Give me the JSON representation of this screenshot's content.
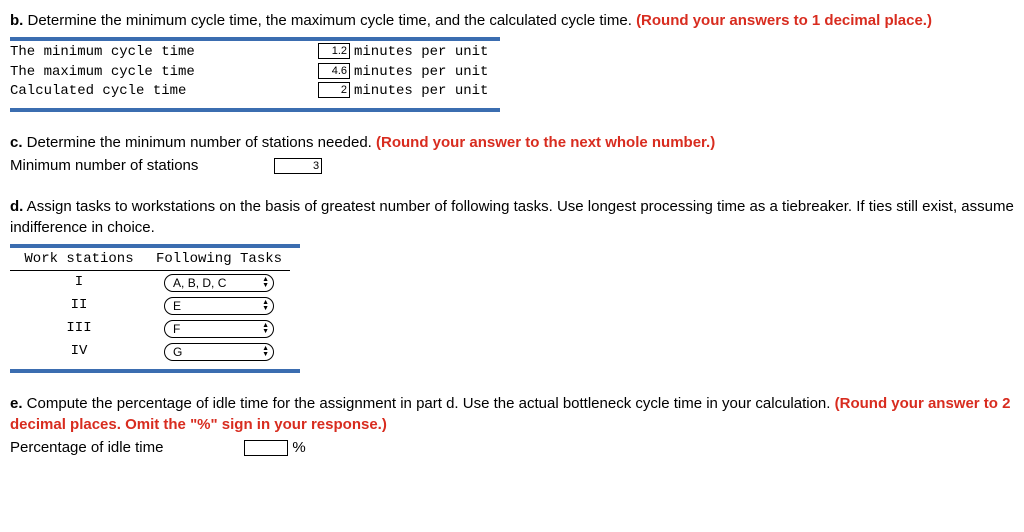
{
  "b": {
    "label": "b.",
    "text": " Determine the minimum cycle time, the maximum cycle time, and the calculated cycle time. ",
    "hint": "(Round your answers to 1 decimal place.)",
    "rows": [
      {
        "label": "The minimum cycle time",
        "value": "1.2",
        "unit": "minutes per unit"
      },
      {
        "label": "The maximum cycle time",
        "value": "4.6",
        "unit": "minutes per unit"
      },
      {
        "label": "Calculated cycle time",
        "value": "2",
        "unit": "minutes per unit"
      }
    ]
  },
  "c": {
    "label": "c.",
    "text": " Determine the minimum number of stations needed. ",
    "hint": "(Round your answer to the next whole number.)",
    "field_label": "Minimum number of stations",
    "value": "3"
  },
  "d": {
    "label": "d.",
    "text": " Assign tasks to workstations on the basis of greatest number of following tasks. Use longest processing time as a tiebreaker. If ties still exist, assume indifference in choice.",
    "headers": {
      "ws": "Work stations",
      "ft": "Following Tasks"
    },
    "rows": [
      {
        "ws": "I",
        "val": "A, B, D, C"
      },
      {
        "ws": "II",
        "val": "E"
      },
      {
        "ws": "III",
        "val": "F"
      },
      {
        "ws": "IV",
        "val": "G"
      }
    ]
  },
  "e": {
    "label": "e.",
    "text": " Compute the percentage of idle time for the assignment in part d. Use the actual bottleneck cycle time in your calculation. ",
    "hint": "(Round your answer to 2 decimal places. Omit the \"%\" sign in your response.)",
    "field_label": "Percentage of idle time",
    "value": "",
    "unit": "%"
  }
}
